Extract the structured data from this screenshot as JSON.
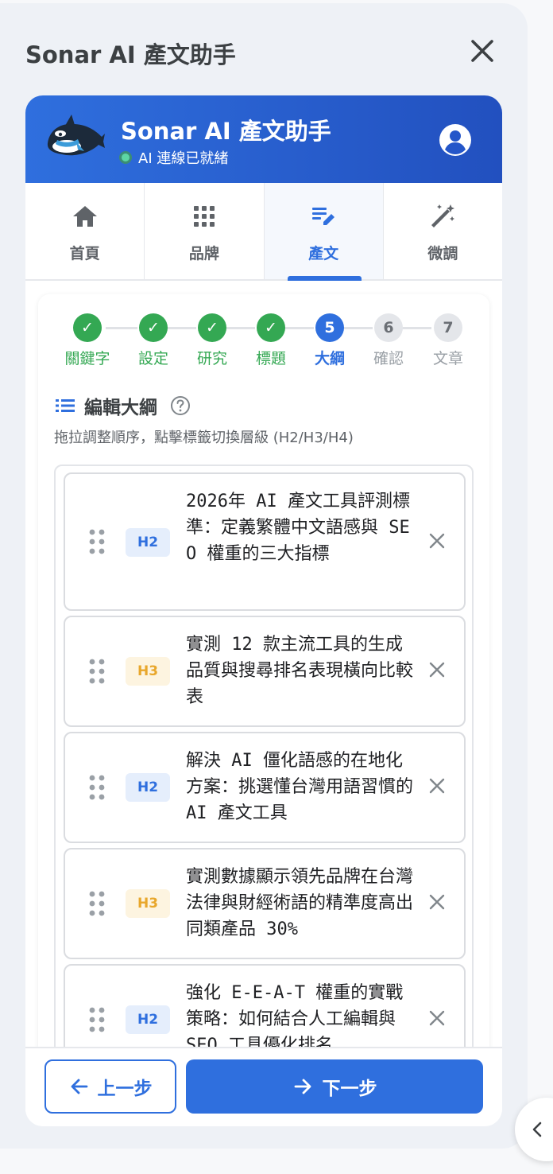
{
  "panel": {
    "title": "Sonar AI 產文助手",
    "close_icon": "close-icon"
  },
  "brand": {
    "title": "Sonar AI 產文助手",
    "status": "AI 連線已就緒",
    "status_color": "#5dd6a4",
    "accent": "#2f6fde",
    "mascot_icon": "orca-mascot-icon",
    "account_icon": "account-circle-icon"
  },
  "tabs": [
    {
      "label": "首頁",
      "icon": "home-icon"
    },
    {
      "label": "品牌",
      "icon": "grid-icon"
    },
    {
      "label": "產文",
      "icon": "edit-note-icon",
      "active": true
    },
    {
      "label": "微調",
      "icon": "magic-wand-icon"
    }
  ],
  "stepper": {
    "current": 5,
    "steps": [
      {
        "number": "1",
        "label": "關鍵字",
        "state": "done"
      },
      {
        "number": "2",
        "label": "設定",
        "state": "done"
      },
      {
        "number": "3",
        "label": "研究",
        "state": "done"
      },
      {
        "number": "4",
        "label": "標題",
        "state": "done"
      },
      {
        "number": "5",
        "label": "大綱",
        "state": "current"
      },
      {
        "number": "6",
        "label": "確認",
        "state": "todo"
      },
      {
        "number": "7",
        "label": "文章",
        "state": "todo"
      }
    ]
  },
  "outline": {
    "title": "編輯大綱",
    "subtitle": "拖拉調整順序，點擊標籤切換層級 (H2/H3/H4)",
    "items": [
      {
        "level": "H2",
        "text": "2026年 AI 產文工具評測標準：定義繁體中文語感與 SEO 權重的三大指標"
      },
      {
        "level": "H3",
        "text": "實測 12 款主流工具的生成品質與搜尋排名表現橫向比較表"
      },
      {
        "level": "H2",
        "text": "解決 AI 僵化語感的在地化方案：挑選懂台灣用語習慣的 AI 產文工具"
      },
      {
        "level": "H3",
        "text": "實測數據顯示領先品牌在台灣法律與財經術語的精準度高出同類產品 30%"
      },
      {
        "level": "H2",
        "text": "強化 E-E-A-T 權重的實戰策略：如何結合人工編輯與 SEO 工具優化排名"
      }
    ]
  },
  "footer": {
    "prev_label": "上一步",
    "next_label": "下一步"
  }
}
